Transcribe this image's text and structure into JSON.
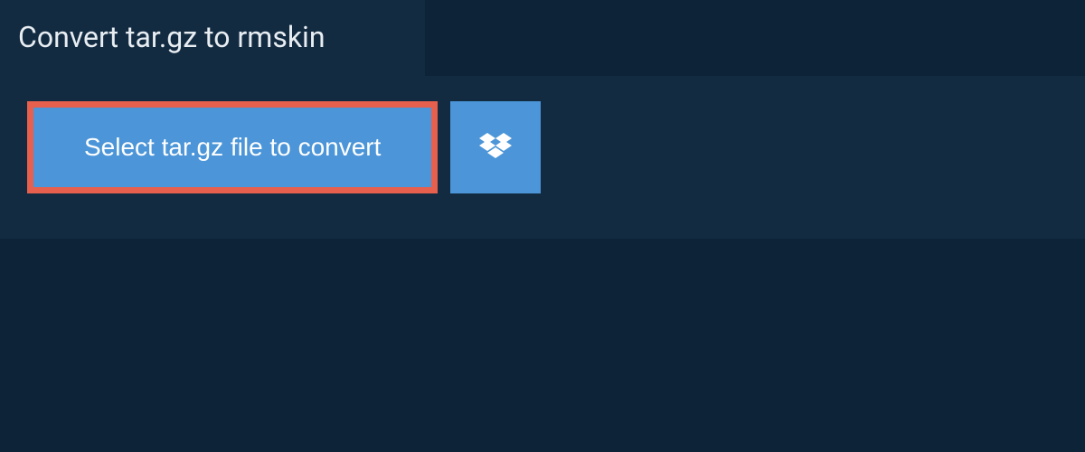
{
  "header": {
    "title": "Convert tar.gz to rmskin"
  },
  "actions": {
    "select_file_label": "Select tar.gz file to convert"
  },
  "colors": {
    "highlight_border": "#e7604e",
    "button_bg": "#4b95d8",
    "panel_bg": "#122b41",
    "page_bg": "#0d2438"
  }
}
